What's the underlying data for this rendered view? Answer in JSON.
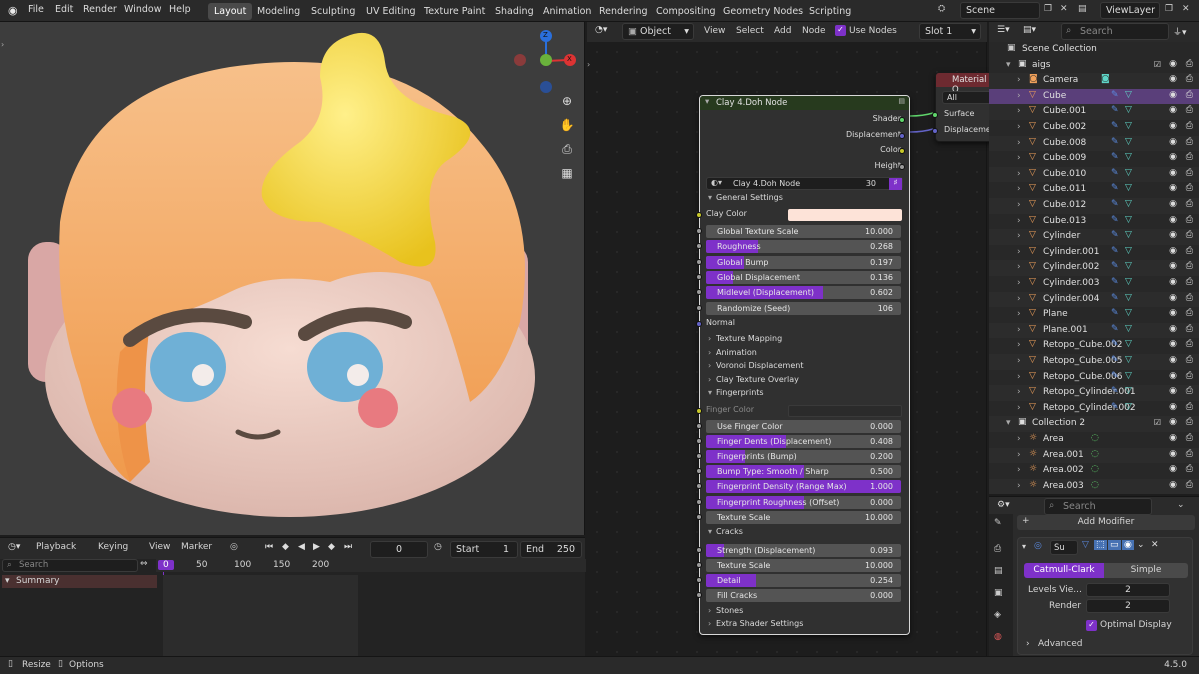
{
  "topbar": {
    "menus": [
      "File",
      "Edit",
      "Render",
      "Window",
      "Help"
    ],
    "workspaces": [
      "Layout",
      "Modeling",
      "Sculpting",
      "UV Editing",
      "Texture Paint",
      "Shading",
      "Animation",
      "Rendering",
      "Compositing",
      "Geometry Nodes",
      "Scripting"
    ],
    "active_workspace": "Layout",
    "scene": "Scene",
    "view_layer": "ViewLayer"
  },
  "viewport": {
    "gizmo": {
      "z": "Z",
      "x": "X"
    }
  },
  "timeline": {
    "menus": [
      "Playback",
      "Keying",
      "View",
      "Marker"
    ],
    "current_frame": "0",
    "start_label": "Start",
    "start": "1",
    "end_label": "End",
    "end": "250",
    "search_placeholder": "Search",
    "ruler": [
      "0",
      "50",
      "100",
      "150",
      "200"
    ],
    "summary": "Summary"
  },
  "node_editor": {
    "mode": "Object",
    "menus": [
      "View",
      "Select",
      "Add",
      "Node"
    ],
    "use_nodes": "Use Nodes",
    "slot": "Slot 1",
    "material_output": {
      "title": "Material O",
      "target": "All",
      "sockets": [
        "Surface",
        "Displaceme"
      ]
    },
    "node": {
      "title": "Clay 4.Doh Node",
      "outputs": [
        "Shader",
        "Displacement",
        "Color",
        "Height"
      ],
      "group_name": "Clay 4.Doh Node",
      "group_users": "30",
      "general_settings": "General Settings",
      "clay_color_label": "Clay Color",
      "clay_color": "#fde3d8",
      "sliders_general": [
        {
          "label": "Global Texture Scale",
          "value": "10.000",
          "fill": 0
        },
        {
          "label": "Roughness",
          "value": "0.268",
          "fill": 0.268
        },
        {
          "label": "Global Bump",
          "value": "0.197",
          "fill": 0.197
        },
        {
          "label": "Global Displacement",
          "value": "0.136",
          "fill": 0.136
        },
        {
          "label": "Midlevel (Displacement)",
          "value": "0.602",
          "fill": 0.602
        },
        {
          "label": "Randomize (Seed)",
          "value": "106",
          "fill": 0
        }
      ],
      "normal": "Normal",
      "collapsed_panels": [
        "Texture Mapping",
        "Animation",
        "Voronoi Displacement",
        "Clay Texture Overlay"
      ],
      "fingerprints": "Fingerprints",
      "finger_color": "Finger Color",
      "sliders_finger": [
        {
          "label": "Use Finger Color",
          "value": "0.000",
          "fill": 0
        },
        {
          "label": "Finger Dents (Displacement)",
          "value": "0.408",
          "fill": 0.408
        },
        {
          "label": "Fingerprints (Bump)",
          "value": "0.200",
          "fill": 0.2
        },
        {
          "label": "Bump Type: Smooth / Sharp",
          "value": "0.500",
          "fill": 0.5
        },
        {
          "label": "Fingerprint Density (Range Max)",
          "value": "1.000",
          "fill": 1.0
        },
        {
          "label": "Fingerprint Roughness (Offset)",
          "value": "0.000",
          "fill": 0.5
        },
        {
          "label": "Texture Scale",
          "value": "10.000",
          "fill": 0
        }
      ],
      "cracks": "Cracks",
      "sliders_cracks": [
        {
          "label": "Strength (Displacement)",
          "value": "0.093",
          "fill": 0.093
        },
        {
          "label": "Texture Scale",
          "value": "10.000",
          "fill": 0
        },
        {
          "label": "Detail",
          "value": "0.254",
          "fill": 0.254
        },
        {
          "label": "Fill Cracks",
          "value": "0.000",
          "fill": 0
        }
      ],
      "tail_panels": [
        "Stones",
        "Extra Shader Settings"
      ]
    }
  },
  "outliner": {
    "search_placeholder": "Search",
    "scene_collection": "Scene Collection",
    "rows": [
      {
        "name": "aigs",
        "kind": "collection",
        "indent": 1
      },
      {
        "name": "Camera",
        "kind": "camera",
        "indent": 2
      },
      {
        "name": "Cube",
        "kind": "mesh",
        "indent": 2,
        "selected": true
      },
      {
        "name": "Cube.001",
        "kind": "mesh",
        "indent": 2
      },
      {
        "name": "Cube.002",
        "kind": "mesh",
        "indent": 2
      },
      {
        "name": "Cube.008",
        "kind": "mesh",
        "indent": 2
      },
      {
        "name": "Cube.009",
        "kind": "mesh",
        "indent": 2
      },
      {
        "name": "Cube.010",
        "kind": "mesh",
        "indent": 2
      },
      {
        "name": "Cube.011",
        "kind": "mesh",
        "indent": 2
      },
      {
        "name": "Cube.012",
        "kind": "mesh",
        "indent": 2
      },
      {
        "name": "Cube.013",
        "kind": "mesh",
        "indent": 2
      },
      {
        "name": "Cylinder",
        "kind": "mesh",
        "indent": 2
      },
      {
        "name": "Cylinder.001",
        "kind": "mesh",
        "indent": 2
      },
      {
        "name": "Cylinder.002",
        "kind": "mesh",
        "indent": 2
      },
      {
        "name": "Cylinder.003",
        "kind": "mesh",
        "indent": 2
      },
      {
        "name": "Cylinder.004",
        "kind": "mesh",
        "indent": 2
      },
      {
        "name": "Plane",
        "kind": "mesh",
        "indent": 2
      },
      {
        "name": "Plane.001",
        "kind": "mesh",
        "indent": 2
      },
      {
        "name": "Retopo_Cube.002",
        "kind": "mesh",
        "indent": 2
      },
      {
        "name": "Retopo_Cube.005",
        "kind": "mesh",
        "indent": 2
      },
      {
        "name": "Retopo_Cube.006",
        "kind": "mesh",
        "indent": 2
      },
      {
        "name": "Retopo_Cylinder.001",
        "kind": "mesh",
        "indent": 2
      },
      {
        "name": "Retopo_Cylinder.002",
        "kind": "mesh",
        "indent": 2
      },
      {
        "name": "Collection 2",
        "kind": "collection",
        "indent": 1
      },
      {
        "name": "Area",
        "kind": "light",
        "indent": 2
      },
      {
        "name": "Area.001",
        "kind": "light",
        "indent": 2
      },
      {
        "name": "Area.002",
        "kind": "light",
        "indent": 2
      },
      {
        "name": "Area.003",
        "kind": "light",
        "indent": 2
      }
    ]
  },
  "properties": {
    "search_placeholder": "Search",
    "add_modifier": "Add Modifier",
    "modifier_name": "Su",
    "subdiv_types": [
      "Catmull-Clark",
      "Simple"
    ],
    "levels_viewport_label": "Levels Vie...",
    "levels_viewport": "2",
    "render_label": "Render",
    "render": "2",
    "optimal_display": "Optimal Display",
    "advanced": "Advanced"
  },
  "status": {
    "resize": "Resize",
    "options": "Options",
    "version": "4.5.0"
  },
  "colors": {
    "accent": "#7e31c9",
    "selection": "#5a3f7a",
    "blue_active": "#4772b3",
    "mesh_icon": "#f0a05a",
    "modifier_icon": "#5a8adf"
  }
}
